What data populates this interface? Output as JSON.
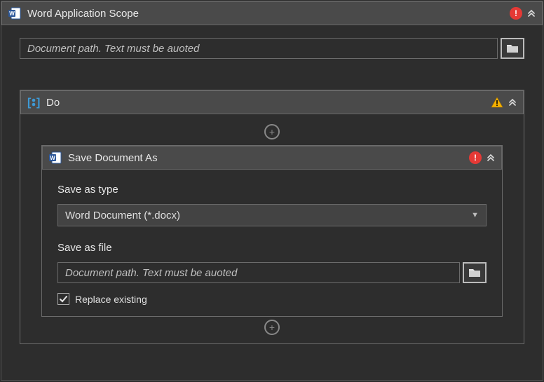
{
  "outer": {
    "title": "Word Application Scope",
    "path_placeholder": "Document path. Text must be auoted",
    "path_value": ""
  },
  "do": {
    "title": "Do"
  },
  "save": {
    "title": "Save Document As",
    "type_label": "Save as type",
    "type_value": "Word Document (*.docx)",
    "file_label": "Save as file",
    "file_placeholder": "Document path. Text must be auoted",
    "file_value": "",
    "replace_label": "Replace existing",
    "replace_checked": true
  },
  "icons": {
    "word": "word-app-icon",
    "sequence": "sequence-icon",
    "error": "!",
    "warning": "!",
    "collapse": "double-chevron-up",
    "add": "+",
    "folder": "folder-icon",
    "check": "check"
  }
}
